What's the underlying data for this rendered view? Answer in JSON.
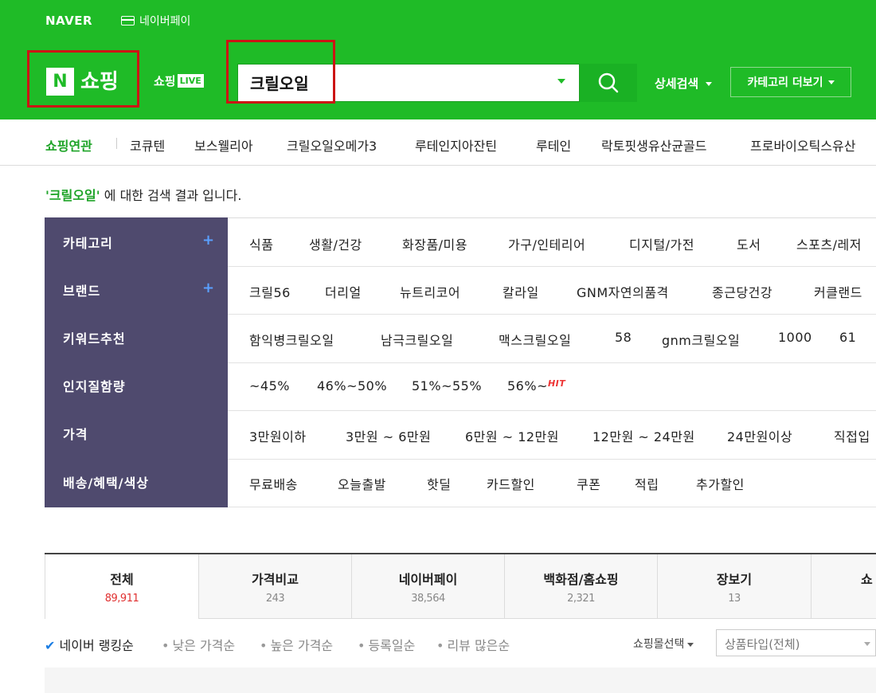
{
  "header": {
    "naver": "NAVER",
    "pay": "네이버페이",
    "shopping": "쇼핑",
    "logo_n": "N",
    "live_prefix": "쇼핑",
    "live_badge": "LIVE",
    "search_value": "크릴오일",
    "detail_search": "상세검색",
    "category_more": "카테고리 더보기",
    "brand_color": "#1fbb27"
  },
  "related": {
    "title": "쇼핑연관",
    "items": [
      "코큐텐",
      "보스웰리아",
      "크릴오일오메가3",
      "루테인지아잔틴",
      "루테인",
      "락토핏생유산균골드",
      "프로바이오틱스유산"
    ]
  },
  "result": {
    "query": "'크릴오일'",
    "suffix": " 에 대한 검색 결과 입니다."
  },
  "filters": [
    {
      "label": "카테고리",
      "items": [
        "식품",
        "생활/건강",
        "화장품/미용",
        "가구/인테리어",
        "디지털/가전",
        "도서",
        "스포츠/레저"
      ]
    },
    {
      "label": "브랜드",
      "items": [
        "크릴56",
        "더리얼",
        "뉴트리코어",
        "칼라일",
        "GNM자연의품격",
        "종근당건강",
        "커클랜드"
      ]
    },
    {
      "label": "키워드추천",
      "items": [
        "함익병크릴오일",
        "남극크릴오일",
        "맥스크릴오일",
        "58",
        "gnm크릴오일",
        "1000",
        "61"
      ]
    },
    {
      "label": "인지질함량",
      "items": [
        "~45%",
        "46%~50%",
        "51%~55%",
        "56%~"
      ],
      "hit": "HIT"
    },
    {
      "label": "가격",
      "items": [
        "3만원이하",
        "3만원 ~ 6만원",
        "6만원 ~ 12만원",
        "12만원 ~ 24만원",
        "24만원이상",
        "직접입"
      ]
    },
    {
      "label": "배송/혜택/색상",
      "items": [
        "무료배송",
        "오늘출발",
        "핫딜",
        "카드할인",
        "쿠폰",
        "적립",
        "추가할인"
      ]
    }
  ],
  "tabs": [
    {
      "label": "전체",
      "count": "89,911"
    },
    {
      "label": "가격비교",
      "count": "243"
    },
    {
      "label": "네이버페이",
      "count": "38,564"
    },
    {
      "label": "백화점/홈쇼핑",
      "count": "2,321"
    },
    {
      "label": "장보기",
      "count": "13"
    },
    {
      "label": "쇼"
    }
  ],
  "sort": {
    "check": "✔",
    "items": [
      "네이버 랭킹순",
      "낮은 가격순",
      "높은 가격순",
      "등록일순",
      "리뷰 많은순"
    ],
    "mall_select": "쇼핑몰선택",
    "type_select": "상품타입(전체)"
  }
}
